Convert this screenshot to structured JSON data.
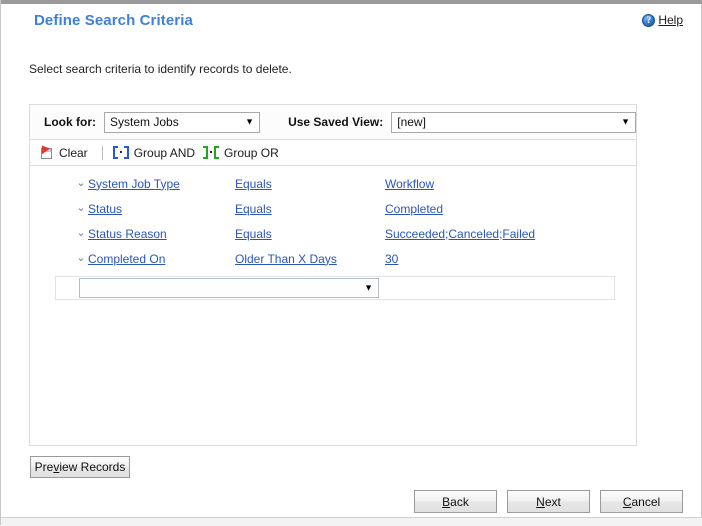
{
  "header": {
    "title": "Define Search Criteria",
    "help_label": "Help",
    "help_icon": "help-circle-icon"
  },
  "instruction": "Select search criteria to identify records to delete.",
  "lookfor_bar": {
    "lookfor_label": "Look for:",
    "lookfor_value": "System Jobs",
    "savedview_label": "Use Saved View:",
    "savedview_value": "[new]",
    "caret": "▼"
  },
  "toolbar": {
    "clear_label": "Clear",
    "group_and_label": "Group AND",
    "group_or_label": "Group OR",
    "clear_icon": "clear-page-icon",
    "group_and_icon": "group-and-brackets-icon",
    "group_or_icon": "group-or-brackets-icon"
  },
  "criteria": {
    "chevron": "⌄",
    "rows": [
      {
        "field": "System Job Type",
        "operator": "Equals",
        "value": "Workflow"
      },
      {
        "field": "Status",
        "operator": "Equals",
        "value": "Completed"
      },
      {
        "field": "Status Reason",
        "operator": "Equals",
        "value": "Succeeded;Canceled;Failed"
      },
      {
        "field": "Completed On",
        "operator": "Older Than X Days",
        "value": "30"
      }
    ],
    "new_row_value": "",
    "new_row_caret": "▼"
  },
  "buttons": {
    "preview_prefix": "Pre",
    "preview_accel": "v",
    "preview_suffix": "iew Records",
    "back_accel": "B",
    "back_rest": "ack",
    "next_accel": "N",
    "next_rest": "ext",
    "cancel_accel": "C",
    "cancel_rest": "ancel"
  },
  "colors": {
    "title_blue": "#3f7fdd",
    "link_blue": "#2a56b8",
    "group_and_blue": "#2a58d8",
    "group_or_green": "#24a324",
    "clear_red": "#e03a2f"
  }
}
